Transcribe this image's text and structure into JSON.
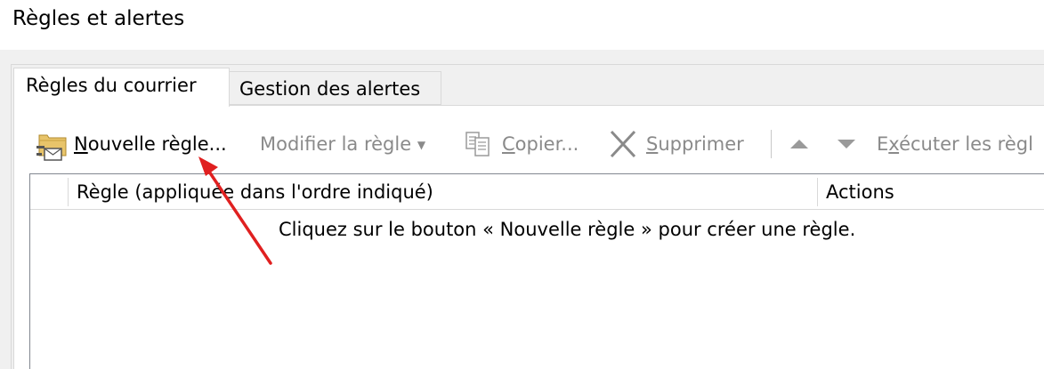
{
  "window": {
    "title": "Règles et alertes"
  },
  "tabs": [
    {
      "label": "Règles du courrier",
      "active": true
    },
    {
      "label": "Gestion des alertes",
      "active": false
    }
  ],
  "toolbar": {
    "new_rule": {
      "mnemonic": "N",
      "rest": "ouvelle règle...",
      "icon": "new-rule-icon",
      "enabled": true
    },
    "modify_rule": {
      "label": "Modifier la règle",
      "icon": "dropdown-caret-icon",
      "enabled": false
    },
    "copy": {
      "mnemonic": "C",
      "rest": "opier...",
      "icon": "copy-icon",
      "enabled": false
    },
    "delete": {
      "mnemonic": "S",
      "rest": "upprimer",
      "icon": "delete-x-icon",
      "enabled": false
    },
    "move_up": {
      "icon": "move-up-icon",
      "enabled": false
    },
    "move_down": {
      "icon": "move-down-icon",
      "enabled": false
    },
    "run_rules": {
      "prefix": "E",
      "mnemonic": "x",
      "rest": "écuter les règl",
      "enabled": false
    }
  },
  "rules_list": {
    "columns": [
      "Règle (appliquée dans l'ordre indiqué)",
      "Actions"
    ],
    "empty_message": "Cliquez sur le bouton « Nouvelle règle » pour créer une règle."
  },
  "colors": {
    "annotation_arrow": "#e02020",
    "disabled_text": "#8a8a8a"
  }
}
